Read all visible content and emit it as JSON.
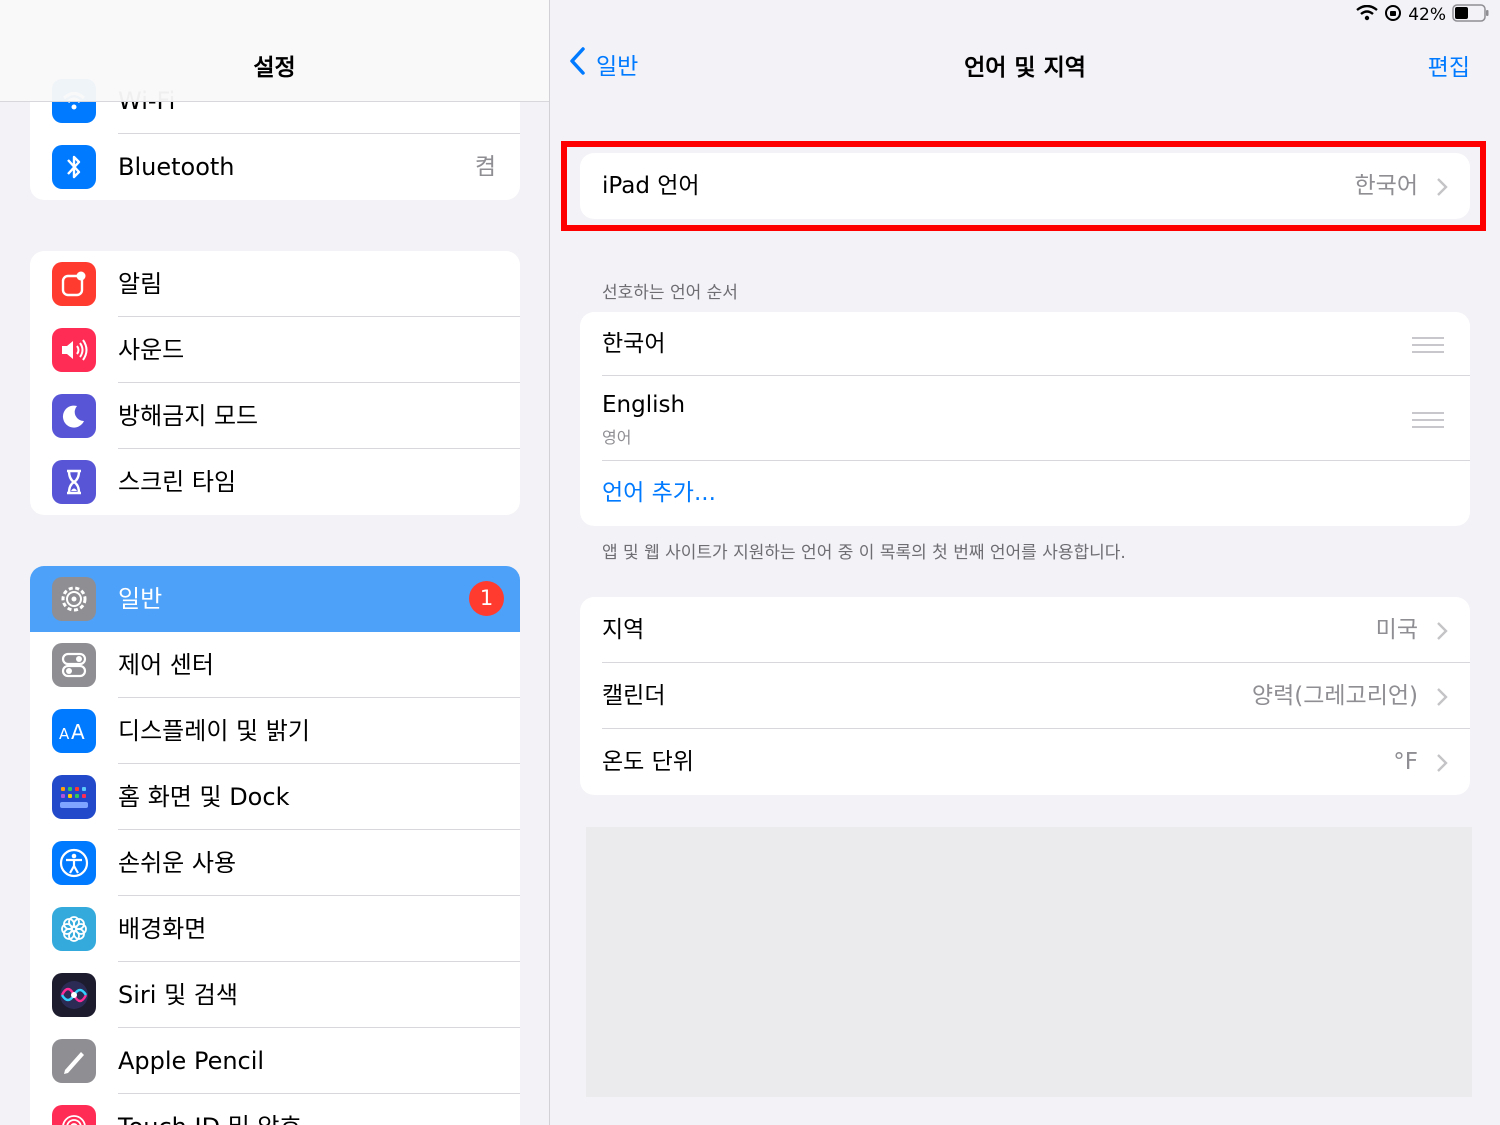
{
  "status_bar": {
    "battery": "42%"
  },
  "sidebar": {
    "title": "설정",
    "group1": [
      {
        "label": "Wi-Fi",
        "value": ""
      },
      {
        "label": "Bluetooth",
        "value": "켬"
      }
    ],
    "group2": [
      {
        "label": "알림"
      },
      {
        "label": "사운드"
      },
      {
        "label": "방해금지 모드"
      },
      {
        "label": "스크린 타임"
      }
    ],
    "group3": [
      {
        "label": "일반",
        "badge": "1"
      },
      {
        "label": "제어 센터"
      },
      {
        "label": "디스플레이 및 밝기"
      },
      {
        "label": "홈 화면 및 Dock"
      },
      {
        "label": "손쉬운 사용"
      },
      {
        "label": "배경화면"
      },
      {
        "label": "Siri 및 검색"
      },
      {
        "label": "Apple Pencil"
      },
      {
        "label": "Touch ID 및 암호"
      }
    ]
  },
  "detail": {
    "back_label": "일반",
    "title": "언어 및 지역",
    "edit_label": "편집",
    "ipad_language": {
      "label": "iPad 언어",
      "value": "한국어"
    },
    "preferred_header": "선호하는 언어 순서",
    "languages": [
      {
        "name": "한국어",
        "sub": ""
      },
      {
        "name": "English",
        "sub": "영어"
      }
    ],
    "add_language": "언어 추가...",
    "footer_note": "앱 및 웹 사이트가 지원하는 언어 중 이 목록의 첫 번째 언어를 사용합니다.",
    "region_rows": [
      {
        "label": "지역",
        "value": "미국"
      },
      {
        "label": "캘린더",
        "value": "양력(그레고리언)"
      },
      {
        "label": "온도 단위",
        "value": "°F"
      }
    ]
  }
}
